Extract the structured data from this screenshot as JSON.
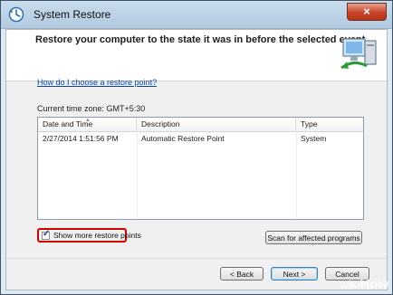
{
  "window": {
    "title": "System Restore",
    "close_label": "×"
  },
  "header": {
    "title": "Restore your computer to the state it was in before the selected event"
  },
  "link": {
    "text": "How do I choose a restore point?"
  },
  "timezone": {
    "text": "Current time zone: GMT+5:30"
  },
  "table": {
    "columns": [
      "Date and Time",
      "Description",
      "Type"
    ],
    "rows": [
      [
        "2/27/2014 1:51:56 PM",
        "Automatic Restore Point",
        "System"
      ]
    ]
  },
  "options": {
    "show_more_label": "Show more restore points",
    "show_more_checked": true
  },
  "buttons": {
    "scan": "Scan for affected programs",
    "back": "< Back",
    "next": "Next >",
    "cancel": "Cancel"
  },
  "watermark": {
    "wiki": "wiki",
    "how": "How"
  }
}
